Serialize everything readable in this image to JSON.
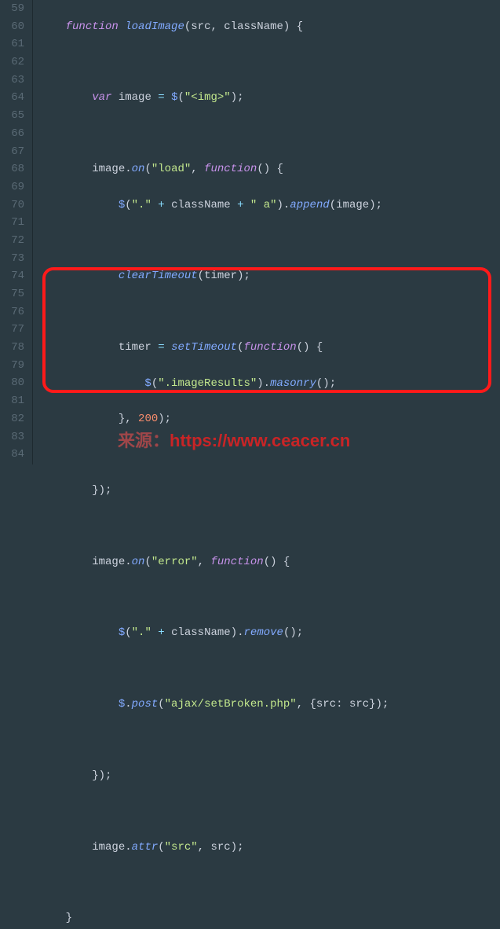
{
  "gutter": {
    "start": 59,
    "end": 84
  },
  "code": {
    "l59_kw": "function",
    "l59_name": "loadImage",
    "l59_p1": "src",
    "l59_p2": "className",
    "l61_var": "var",
    "l61_id": "image",
    "l61_dol": "$",
    "l61_str": "\"<img>\"",
    "l63_id": "image",
    "l63_on": "on",
    "l63_str": "\"load\"",
    "l63_fn": "function",
    "l64_dol": "$",
    "l64_s1": "\".\"",
    "l64_plus": "+",
    "l64_id": "className",
    "l64_s2": "\" a\"",
    "l64_app": "append",
    "l64_arg": "image",
    "l66_fn": "clearTimeout",
    "l66_arg": "timer",
    "l68_id": "timer",
    "l68_fn": "setTimeout",
    "l68_kw": "function",
    "l69_dol": "$",
    "l69_str": "\".imageResults\"",
    "l69_call": "masonry",
    "l70_num": "200",
    "l74_id": "image",
    "l74_on": "on",
    "l74_str": "\"error\"",
    "l74_fn": "function",
    "l76_dol": "$",
    "l76_s1": "\".\"",
    "l76_id": "className",
    "l76_call": "remove",
    "l78_dol": "$",
    "l78_post": "post",
    "l78_s1": "\"ajax/setBroken.php\"",
    "l78_k": "src",
    "l78_v": "src",
    "l82_id": "image",
    "l82_attr": "attr",
    "l82_s1": "\"src\"",
    "l82_arg": "src"
  },
  "watermark": {
    "prefix": "来源：",
    "url": "https://www.ceacer.cn"
  }
}
